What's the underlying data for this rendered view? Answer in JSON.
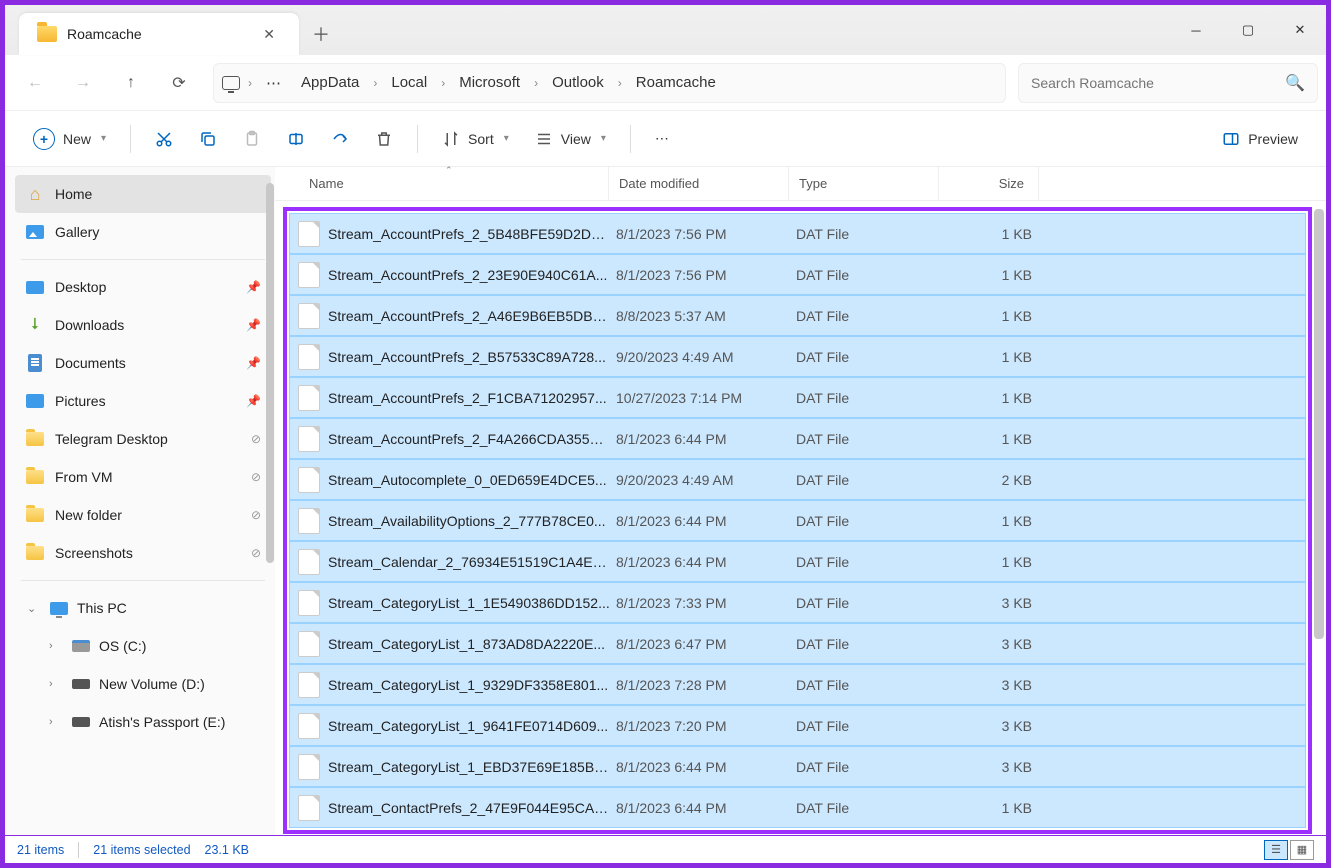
{
  "tab": {
    "title": "Roamcache"
  },
  "breadcrumbs": [
    "AppData",
    "Local",
    "Microsoft",
    "Outlook",
    "Roamcache"
  ],
  "search": {
    "placeholder": "Search Roamcache"
  },
  "toolbar": {
    "new": "New",
    "sort": "Sort",
    "view": "View",
    "preview": "Preview"
  },
  "sidebar": {
    "home": "Home",
    "gallery": "Gallery",
    "pinned": [
      {
        "label": "Desktop",
        "icon": "desktop"
      },
      {
        "label": "Downloads",
        "icon": "down"
      },
      {
        "label": "Documents",
        "icon": "doc"
      },
      {
        "label": "Pictures",
        "icon": "pic"
      },
      {
        "label": "Telegram Desktop",
        "icon": "folder"
      },
      {
        "label": "From VM",
        "icon": "folder"
      },
      {
        "label": "New folder",
        "icon": "folder"
      },
      {
        "label": "Screenshots",
        "icon": "folder"
      }
    ],
    "thispc": "This PC",
    "drives": [
      {
        "label": "OS (C:)",
        "icon": "drive"
      },
      {
        "label": "New Volume (D:)",
        "icon": "drive2"
      },
      {
        "label": "Atish's Passport  (E:)",
        "icon": "drive2"
      }
    ]
  },
  "columns": {
    "name": "Name",
    "date": "Date modified",
    "type": "Type",
    "size": "Size"
  },
  "files": [
    {
      "name": "Stream_AccountPrefs_2_5B48BFE59D2DD...",
      "date": "8/1/2023 7:56 PM",
      "type": "DAT File",
      "size": "1 KB"
    },
    {
      "name": "Stream_AccountPrefs_2_23E90E940C61A...",
      "date": "8/1/2023 7:56 PM",
      "type": "DAT File",
      "size": "1 KB"
    },
    {
      "name": "Stream_AccountPrefs_2_A46E9B6EB5DB2...",
      "date": "8/8/2023 5:37 AM",
      "type": "DAT File",
      "size": "1 KB"
    },
    {
      "name": "Stream_AccountPrefs_2_B57533C89A728...",
      "date": "9/20/2023 4:49 AM",
      "type": "DAT File",
      "size": "1 KB"
    },
    {
      "name": "Stream_AccountPrefs_2_F1CBA71202957...",
      "date": "10/27/2023 7:14 PM",
      "type": "DAT File",
      "size": "1 KB"
    },
    {
      "name": "Stream_AccountPrefs_2_F4A266CDA355E...",
      "date": "8/1/2023 6:44 PM",
      "type": "DAT File",
      "size": "1 KB"
    },
    {
      "name": "Stream_Autocomplete_0_0ED659E4DCE5...",
      "date": "9/20/2023 4:49 AM",
      "type": "DAT File",
      "size": "2 KB"
    },
    {
      "name": "Stream_AvailabilityOptions_2_777B78CE0...",
      "date": "8/1/2023 6:44 PM",
      "type": "DAT File",
      "size": "1 KB"
    },
    {
      "name": "Stream_Calendar_2_76934E51519C1A4EA...",
      "date": "8/1/2023 6:44 PM",
      "type": "DAT File",
      "size": "1 KB"
    },
    {
      "name": "Stream_CategoryList_1_1E5490386DD152...",
      "date": "8/1/2023 7:33 PM",
      "type": "DAT File",
      "size": "3 KB"
    },
    {
      "name": "Stream_CategoryList_1_873AD8DA2220E...",
      "date": "8/1/2023 6:47 PM",
      "type": "DAT File",
      "size": "3 KB"
    },
    {
      "name": "Stream_CategoryList_1_9329DF3358E801...",
      "date": "8/1/2023 7:28 PM",
      "type": "DAT File",
      "size": "3 KB"
    },
    {
      "name": "Stream_CategoryList_1_9641FE0714D609...",
      "date": "8/1/2023 7:20 PM",
      "type": "DAT File",
      "size": "3 KB"
    },
    {
      "name": "Stream_CategoryList_1_EBD37E69E185B6...",
      "date": "8/1/2023 6:44 PM",
      "type": "DAT File",
      "size": "3 KB"
    },
    {
      "name": "Stream_ContactPrefs_2_47E9F044E95CA0...",
      "date": "8/1/2023 6:44 PM",
      "type": "DAT File",
      "size": "1 KB"
    }
  ],
  "status": {
    "count": "21 items",
    "selected": "21 items selected",
    "size": "23.1 KB"
  }
}
